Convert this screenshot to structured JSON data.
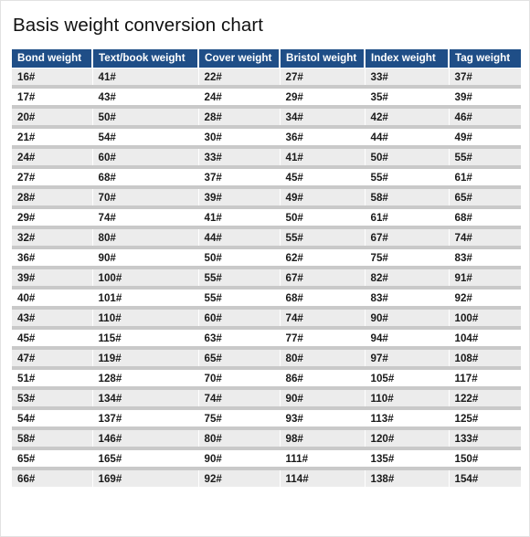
{
  "document": {
    "title": "Basis weight conversion chart"
  },
  "table": {
    "headers": [
      "Bond weight",
      "Text/book weight",
      "Cover weight",
      "Bristol weight",
      "Index weight",
      "Tag weight"
    ],
    "header_bg": "#1f4e87",
    "header_text_color": "#ffffff",
    "row_stripe_color": "#ececec",
    "row_alt_color": "#ffffff",
    "row_separator_color": "#c9c9c9",
    "rows": [
      [
        "16#",
        "41#",
        "22#",
        "27#",
        "33#",
        "37#"
      ],
      [
        "17#",
        "43#",
        "24#",
        "29#",
        "35#",
        "39#"
      ],
      [
        "20#",
        "50#",
        "28#",
        "34#",
        "42#",
        "46#"
      ],
      [
        "21#",
        "54#",
        "30#",
        "36#",
        "44#",
        "49#"
      ],
      [
        "24#",
        "60#",
        "33#",
        "41#",
        "50#",
        "55#"
      ],
      [
        "27#",
        "68#",
        "37#",
        "45#",
        "55#",
        "61#"
      ],
      [
        "28#",
        "70#",
        "39#",
        "49#",
        "58#",
        "65#"
      ],
      [
        "29#",
        "74#",
        "41#",
        "50#",
        "61#",
        "68#"
      ],
      [
        "32#",
        "80#",
        "44#",
        "55#",
        "67#",
        "74#"
      ],
      [
        "36#",
        "90#",
        "50#",
        "62#",
        "75#",
        "83#"
      ],
      [
        "39#",
        "100#",
        "55#",
        "67#",
        "82#",
        "91#"
      ],
      [
        "40#",
        "101#",
        "55#",
        "68#",
        "83#",
        "92#"
      ],
      [
        "43#",
        "110#",
        "60#",
        "74#",
        "90#",
        "100#"
      ],
      [
        "45#",
        "115#",
        "63#",
        "77#",
        "94#",
        "104#"
      ],
      [
        "47#",
        "119#",
        "65#",
        "80#",
        "97#",
        "108#"
      ],
      [
        "51#",
        "128#",
        "70#",
        "86#",
        "105#",
        "117#"
      ],
      [
        "53#",
        "134#",
        "74#",
        "90#",
        "110#",
        "122#"
      ],
      [
        "54#",
        "137#",
        "75#",
        "93#",
        "113#",
        "125#"
      ],
      [
        "58#",
        "146#",
        "80#",
        "98#",
        "120#",
        "133#"
      ],
      [
        "65#",
        "165#",
        "90#",
        "111#",
        "135#",
        "150#"
      ],
      [
        "66#",
        "169#",
        "92#",
        "114#",
        "138#",
        "154#"
      ]
    ]
  }
}
